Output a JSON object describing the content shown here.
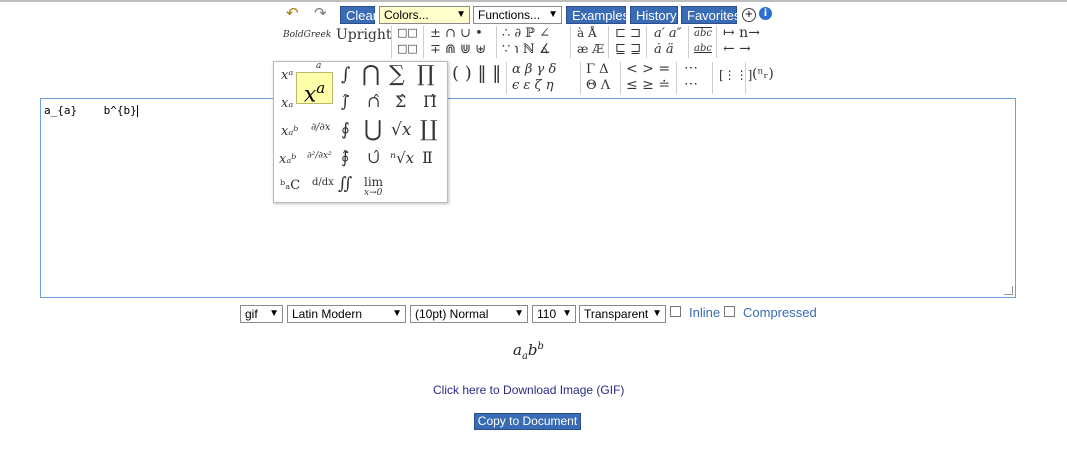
{
  "toolbar": {
    "undo_icon": "undo-icon",
    "redo_icon": "redo-icon",
    "clear_label": "Clear",
    "colors_value": "Colors...",
    "functions_value": "Functions...",
    "examples_label": "Examples",
    "history_label": "History",
    "favorites_label": "Favorites",
    "add_icon": "plus-icon",
    "info_icon": "info-icon"
  },
  "palette": {
    "boldgreek": "BoldGreek",
    "upright": "Upright",
    "boxes1": "□□",
    "boxes2": "□□",
    "ops1": "± ∩ ∪ •",
    "ops2": "∓ ⋒ ⋓ ⊎",
    "logic1": "∴ ∂ ℙ ∠",
    "logic2": "∵ ℩ ℕ ∡",
    "acc1": "à Å",
    "acc2": "æ Æ",
    "sub1": "⊏ ⊐",
    "sub2": "⊑ ⊒",
    "prime1": "a′ a″",
    "prime2": "ȧ ä",
    "abc1": "abc",
    "abc2": "abc",
    "arrow1": "↦ n→",
    "arrow2": "← →",
    "delims": "( ) ‖ ‖",
    "greek1": "α β γ δ",
    "greek2": "ϵ ε ζ η",
    "cap1": "Γ Δ",
    "cap2": "Θ Λ",
    "rel1": "< > =",
    "rel2": "≤ ≥ ≐",
    "dots1": "⋯",
    "dots2": "⋯",
    "matrix": "[⋮⋮]",
    "binom": "(ⁿᵣ)"
  },
  "popup": {
    "items": [
      "xᵃ",
      "a",
      "∫",
      "⋂",
      "∑",
      "∏",
      "xₐ",
      "∫̂",
      "∩̂",
      "Σ̂",
      "Π̂",
      "xₐᵇ",
      "∂/∂x",
      "∮",
      "⋃",
      "√x",
      "∐",
      "xₐᵇ",
      "∂²/∂x²",
      "∮̂",
      "∪̂",
      "ⁿ√x",
      "Ⅱ",
      "ᵇₐC",
      "d/dx",
      "∬",
      "lim",
      "x→0"
    ]
  },
  "editor": {
    "content": "a_{a}    b^{b}"
  },
  "options": {
    "format": "gif",
    "font": "Latin Modern",
    "size": "(10pt) Normal",
    "dpi": "110",
    "background": "Transparent",
    "inline_label": "Inline",
    "compressed_label": "Compressed"
  },
  "preview": {
    "base1": "a",
    "sub1": "a",
    "base2": "b",
    "sup2": "b"
  },
  "download_link": "Click here to Download Image (GIF)",
  "copy_button": "Copy to Document",
  "colors": {
    "button_blue": "#3a6bb5",
    "editor_border": "#6aa1d8",
    "highlight": "#ffffaa"
  }
}
